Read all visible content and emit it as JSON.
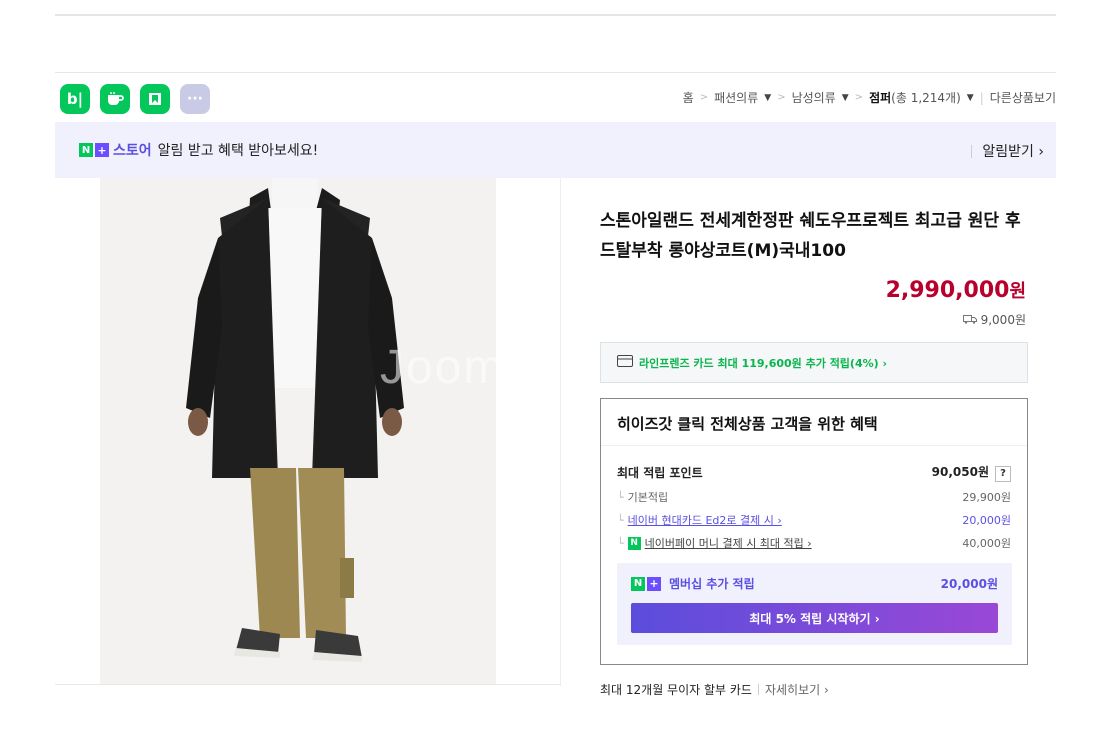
{
  "apps": [
    {
      "name": "blog-icon",
      "glyph": "b|"
    },
    {
      "name": "cafe-icon",
      "glyph": ""
    },
    {
      "name": "bookmark-icon",
      "glyph": ""
    },
    {
      "name": "more-icon",
      "glyph": "···"
    }
  ],
  "breadcrumb": {
    "home": "홈",
    "level1": "패션의류",
    "level2": "남성의류",
    "level3": "점퍼",
    "count": "(총 1,214개)",
    "other": "다른상품보기"
  },
  "banner": {
    "n_badge": "N",
    "plus_badge": "+",
    "store": "스토어",
    "text": "알림 받고 혜택 받아보세요!",
    "action": "알림받기 ›"
  },
  "image": {
    "watermark": "Joom"
  },
  "product": {
    "title": "스톤아일랜드 전세계한정판 쉐도우프로젝트 최고급 원단 후드탈부착 롱야상코트(M)국내100",
    "price": "2,990,000",
    "price_unit": "원",
    "shipping": "9,000원"
  },
  "card_offer": "라인프렌즈 카드 최대 119,600원 추가 적립(4%) ›",
  "benefit": {
    "title": "히이즈갓 클릭 전체상품 고객을 위한 혜택",
    "max_points_label": "최대 적립 포인트",
    "max_points_value": "90,050원",
    "question": "?",
    "rows": [
      {
        "label": "기본적립",
        "value": "29,900원"
      },
      {
        "label": "네이버 현대카드 Ed2로 결제 시 ›",
        "value": "20,000원"
      },
      {
        "label": "네이버페이 머니 결제 시 최대 적립 ›",
        "value": "40,000원"
      }
    ],
    "member_label": "멤버십 추가 적립",
    "member_value": "20,000원",
    "member_button": "최대 5% 적립 시작하기 ›"
  },
  "installment": {
    "text": "최대 12개월 무이자 할부 카드",
    "more": "자세히보기 ›"
  },
  "colors": {
    "naver_green": "#03c75a",
    "accent_purple": "#5a4fe3",
    "price_red": "#b8002c"
  }
}
